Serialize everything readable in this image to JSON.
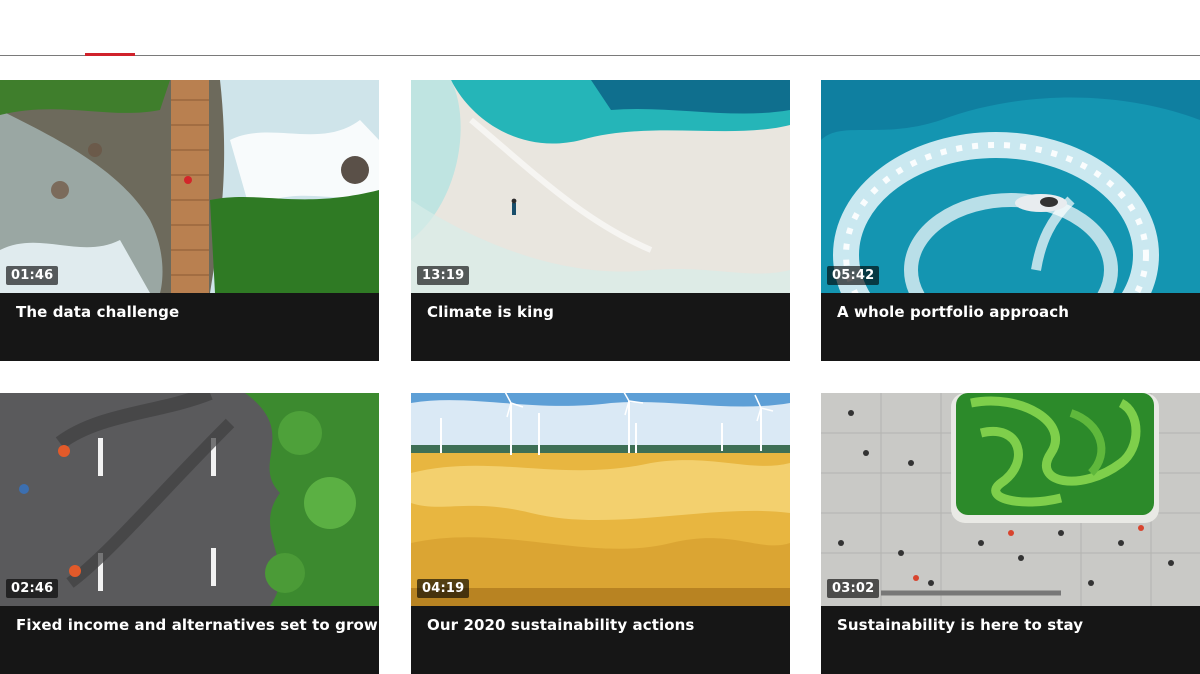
{
  "videos": [
    {
      "title": "The data challenge",
      "duration": "01:46",
      "thumbnail": "river-bridge-aerial"
    },
    {
      "title": "Climate is king",
      "duration": "13:19",
      "thumbnail": "beach-sandbar-aerial"
    },
    {
      "title": "A whole portfolio approach",
      "duration": "05:42",
      "thumbnail": "jetski-wake-aerial"
    },
    {
      "title": "Fixed income and alternatives set to grow",
      "duration": "02:46",
      "thumbnail": "cyclists-road-aerial"
    },
    {
      "title": "Our 2020 sustainability actions",
      "duration": "04:19",
      "thumbnail": "desert-wind-turbines"
    },
    {
      "title": "Sustainability is here to stay",
      "duration": "03:02",
      "thumbnail": "plaza-garden-aerial"
    }
  ],
  "colors": {
    "active_tab_indicator": "#d0222b",
    "caption_background": "#161616"
  }
}
